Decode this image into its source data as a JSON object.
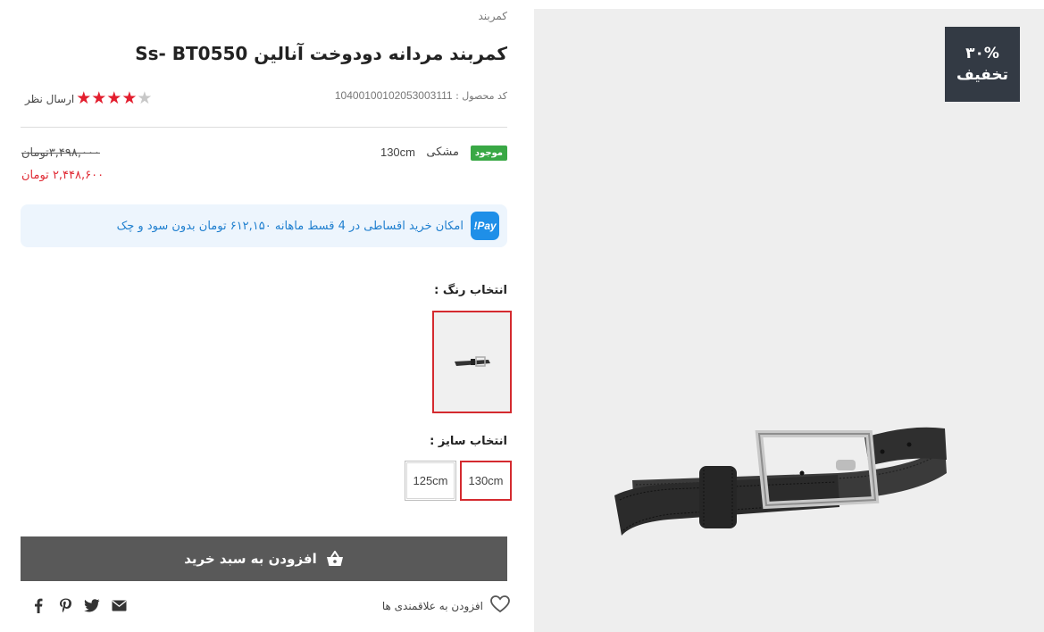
{
  "breadcrumb": "کمربند",
  "product": {
    "title": "کمربند مردانه دودوخت آنالین Ss- BT0550",
    "sku_label": "کد محصول :",
    "sku_value": "10400100102053003111",
    "rating_value": 4,
    "rating_max": 5,
    "review_link": "ارسال نظر"
  },
  "stock": {
    "badge": "موجود",
    "color": "مشکی",
    "size": "130cm"
  },
  "price": {
    "old": "۳,۴۹۸,۰۰۰تومان",
    "new": "۲,۴۴۸,۶۰۰ تومان"
  },
  "installment": {
    "icon_text": "Pay!",
    "text": "امکان خرید اقساطی در 4 قسط ماهانه ۶۱۲,۱۵۰ تومان بدون سود و چک"
  },
  "color_select": {
    "label": "انتخاب رنگ :"
  },
  "size_select": {
    "label": "انتخاب سایز :",
    "options": [
      "130cm",
      "125cm"
    ],
    "selected": "130cm"
  },
  "cart": {
    "label": "افزودن به سبد خرید",
    "icon": "shopping-basket-icon"
  },
  "wishlist": {
    "label": "افزودن به علاقمندی ها",
    "icon": "heart-icon"
  },
  "share": [
    "facebook-icon",
    "pinterest-icon",
    "twitter-icon",
    "email-icon"
  ],
  "discount": {
    "percent": "۳۰%",
    "label": "تخفیف"
  },
  "colors": {
    "accent_red": "#d42a2f",
    "stock_green": "#39a845",
    "cart_bg": "#595959",
    "badge_bg": "#333a44",
    "installment_bg": "#edf5fd",
    "pay_blue": "#1f8fe8"
  }
}
